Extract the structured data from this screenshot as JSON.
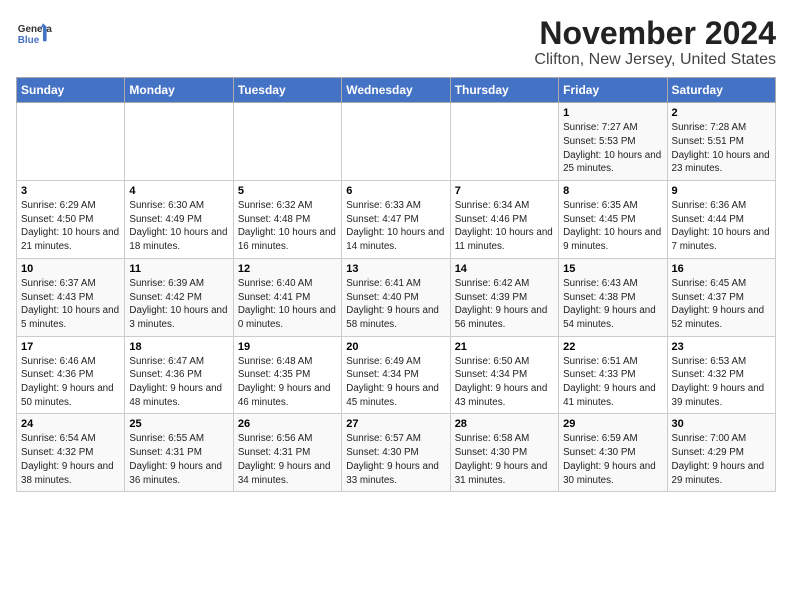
{
  "header": {
    "logo_line1": "General",
    "logo_line2": "Blue",
    "month_year": "November 2024",
    "location": "Clifton, New Jersey, United States"
  },
  "days_of_week": [
    "Sunday",
    "Monday",
    "Tuesday",
    "Wednesday",
    "Thursday",
    "Friday",
    "Saturday"
  ],
  "weeks": [
    [
      {
        "day": "",
        "info": ""
      },
      {
        "day": "",
        "info": ""
      },
      {
        "day": "",
        "info": ""
      },
      {
        "day": "",
        "info": ""
      },
      {
        "day": "",
        "info": ""
      },
      {
        "day": "1",
        "info": "Sunrise: 7:27 AM\nSunset: 5:53 PM\nDaylight: 10 hours and 25 minutes."
      },
      {
        "day": "2",
        "info": "Sunrise: 7:28 AM\nSunset: 5:51 PM\nDaylight: 10 hours and 23 minutes."
      }
    ],
    [
      {
        "day": "3",
        "info": "Sunrise: 6:29 AM\nSunset: 4:50 PM\nDaylight: 10 hours and 21 minutes."
      },
      {
        "day": "4",
        "info": "Sunrise: 6:30 AM\nSunset: 4:49 PM\nDaylight: 10 hours and 18 minutes."
      },
      {
        "day": "5",
        "info": "Sunrise: 6:32 AM\nSunset: 4:48 PM\nDaylight: 10 hours and 16 minutes."
      },
      {
        "day": "6",
        "info": "Sunrise: 6:33 AM\nSunset: 4:47 PM\nDaylight: 10 hours and 14 minutes."
      },
      {
        "day": "7",
        "info": "Sunrise: 6:34 AM\nSunset: 4:46 PM\nDaylight: 10 hours and 11 minutes."
      },
      {
        "day": "8",
        "info": "Sunrise: 6:35 AM\nSunset: 4:45 PM\nDaylight: 10 hours and 9 minutes."
      },
      {
        "day": "9",
        "info": "Sunrise: 6:36 AM\nSunset: 4:44 PM\nDaylight: 10 hours and 7 minutes."
      }
    ],
    [
      {
        "day": "10",
        "info": "Sunrise: 6:37 AM\nSunset: 4:43 PM\nDaylight: 10 hours and 5 minutes."
      },
      {
        "day": "11",
        "info": "Sunrise: 6:39 AM\nSunset: 4:42 PM\nDaylight: 10 hours and 3 minutes."
      },
      {
        "day": "12",
        "info": "Sunrise: 6:40 AM\nSunset: 4:41 PM\nDaylight: 10 hours and 0 minutes."
      },
      {
        "day": "13",
        "info": "Sunrise: 6:41 AM\nSunset: 4:40 PM\nDaylight: 9 hours and 58 minutes."
      },
      {
        "day": "14",
        "info": "Sunrise: 6:42 AM\nSunset: 4:39 PM\nDaylight: 9 hours and 56 minutes."
      },
      {
        "day": "15",
        "info": "Sunrise: 6:43 AM\nSunset: 4:38 PM\nDaylight: 9 hours and 54 minutes."
      },
      {
        "day": "16",
        "info": "Sunrise: 6:45 AM\nSunset: 4:37 PM\nDaylight: 9 hours and 52 minutes."
      }
    ],
    [
      {
        "day": "17",
        "info": "Sunrise: 6:46 AM\nSunset: 4:36 PM\nDaylight: 9 hours and 50 minutes."
      },
      {
        "day": "18",
        "info": "Sunrise: 6:47 AM\nSunset: 4:36 PM\nDaylight: 9 hours and 48 minutes."
      },
      {
        "day": "19",
        "info": "Sunrise: 6:48 AM\nSunset: 4:35 PM\nDaylight: 9 hours and 46 minutes."
      },
      {
        "day": "20",
        "info": "Sunrise: 6:49 AM\nSunset: 4:34 PM\nDaylight: 9 hours and 45 minutes."
      },
      {
        "day": "21",
        "info": "Sunrise: 6:50 AM\nSunset: 4:34 PM\nDaylight: 9 hours and 43 minutes."
      },
      {
        "day": "22",
        "info": "Sunrise: 6:51 AM\nSunset: 4:33 PM\nDaylight: 9 hours and 41 minutes."
      },
      {
        "day": "23",
        "info": "Sunrise: 6:53 AM\nSunset: 4:32 PM\nDaylight: 9 hours and 39 minutes."
      }
    ],
    [
      {
        "day": "24",
        "info": "Sunrise: 6:54 AM\nSunset: 4:32 PM\nDaylight: 9 hours and 38 minutes."
      },
      {
        "day": "25",
        "info": "Sunrise: 6:55 AM\nSunset: 4:31 PM\nDaylight: 9 hours and 36 minutes."
      },
      {
        "day": "26",
        "info": "Sunrise: 6:56 AM\nSunset: 4:31 PM\nDaylight: 9 hours and 34 minutes."
      },
      {
        "day": "27",
        "info": "Sunrise: 6:57 AM\nSunset: 4:30 PM\nDaylight: 9 hours and 33 minutes."
      },
      {
        "day": "28",
        "info": "Sunrise: 6:58 AM\nSunset: 4:30 PM\nDaylight: 9 hours and 31 minutes."
      },
      {
        "day": "29",
        "info": "Sunrise: 6:59 AM\nSunset: 4:30 PM\nDaylight: 9 hours and 30 minutes."
      },
      {
        "day": "30",
        "info": "Sunrise: 7:00 AM\nSunset: 4:29 PM\nDaylight: 9 hours and 29 minutes."
      }
    ]
  ]
}
